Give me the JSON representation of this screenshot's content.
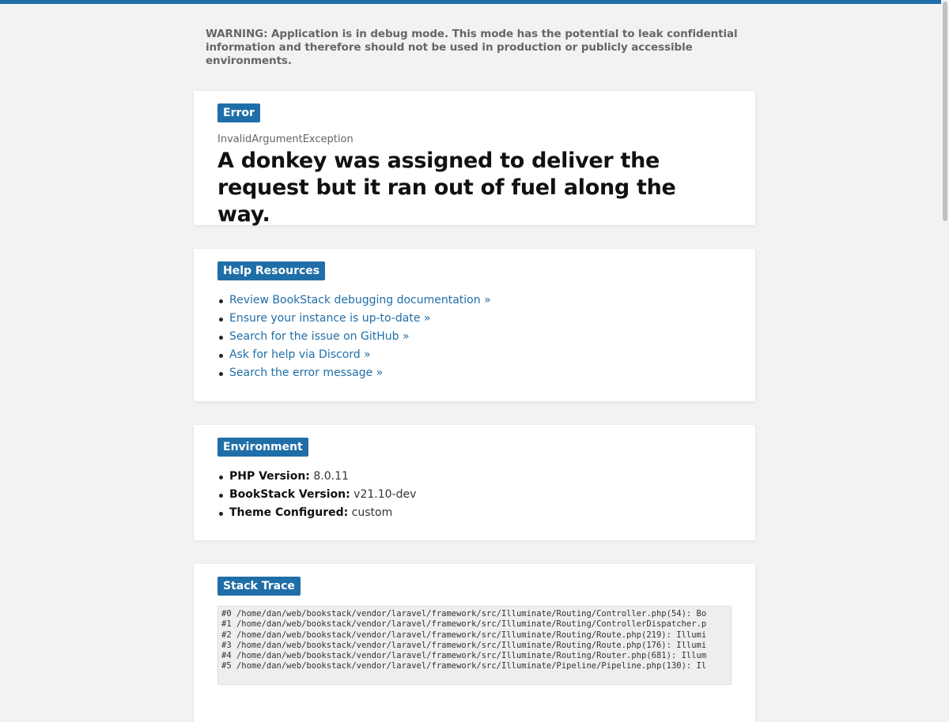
{
  "warning": "WARNING: Application is in debug mode. This mode has the potential to leak confidential information and therefore should not be used in production or publicly accessible environments.",
  "error": {
    "badge": "Error",
    "exception_class": "InvalidArgumentException",
    "message": "A donkey was assigned to deliver the request but it ran out of fuel along the way."
  },
  "help": {
    "badge": "Help Resources",
    "links": [
      {
        "label": "Review BookStack debugging documentation »"
      },
      {
        "label": "Ensure your instance is up-to-date »"
      },
      {
        "label": "Search for the issue on GitHub »"
      },
      {
        "label": "Ask for help via Discord »"
      },
      {
        "label": "Search the error message »"
      }
    ]
  },
  "environment": {
    "badge": "Environment",
    "items": [
      {
        "label": "PHP Version:",
        "value": " 8.0.11"
      },
      {
        "label": "BookStack Version:",
        "value": " v21.10-dev"
      },
      {
        "label": "Theme Configured:",
        "value": " custom"
      }
    ]
  },
  "stack_trace": {
    "badge": "Stack Trace",
    "lines": [
      "#0 /home/dan/web/bookstack/vendor/laravel/framework/src/Illuminate/Routing/Controller.php(54): Bo",
      "#1 /home/dan/web/bookstack/vendor/laravel/framework/src/Illuminate/Routing/ControllerDispatcher.p",
      "#2 /home/dan/web/bookstack/vendor/laravel/framework/src/Illuminate/Routing/Route.php(219): Illumi",
      "#3 /home/dan/web/bookstack/vendor/laravel/framework/src/Illuminate/Routing/Route.php(176): Illumi",
      "#4 /home/dan/web/bookstack/vendor/laravel/framework/src/Illuminate/Routing/Router.php(681): Illum",
      "#5 /home/dan/web/bookstack/vendor/laravel/framework/src/Illuminate/Pipeline/Pipeline.php(130): Il"
    ]
  }
}
